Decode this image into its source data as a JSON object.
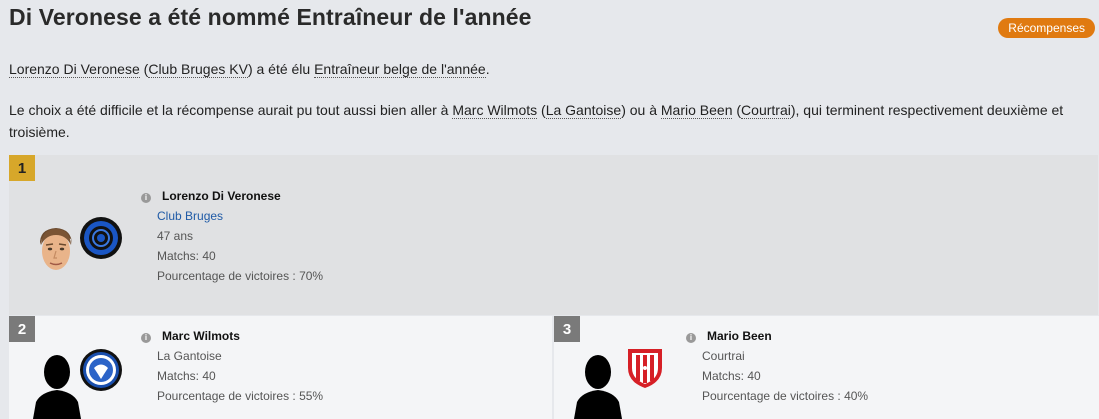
{
  "header": {
    "title": "Di Veronese a été nommé Entraîneur de l'année",
    "badge": "Récompenses"
  },
  "intro": {
    "coach": "Lorenzo Di Veronese",
    "club_open": " (",
    "club": "Club Bruges KV",
    "mid": ") a été élu ",
    "award": "Entraîneur belge de l'année",
    "end": "."
  },
  "detail": {
    "t1": "Le choix a été difficile et la récompense aurait pu tout aussi bien aller à ",
    "coach2": "Marc Wilmots",
    "p1": " (",
    "club2": "La Gantoise",
    "t2": ") ou à ",
    "coach3": "Mario Been",
    "p2": " (",
    "club3": "Courtrai",
    "t3": "), qui terminent respectivement deuxième et troisième."
  },
  "winners": [
    {
      "rank": "1",
      "name": "Lorenzo Di Veronese",
      "club": "Club Bruges",
      "age": "47 ans",
      "matches": "Matchs: 40",
      "win": "Pourcentage de victoires : 70%"
    },
    {
      "rank": "2",
      "name": "Marc Wilmots",
      "club": "La Gantoise",
      "matches": "Matchs: 40",
      "win": "Pourcentage de victoires : 55%"
    },
    {
      "rank": "3",
      "name": "Mario Been",
      "club": "Courtrai",
      "matches": "Matchs: 40",
      "win": "Pourcentage de victoires : 40%"
    }
  ],
  "colors": {
    "accent": "#e07a10",
    "gold": "#d7a72a",
    "link": "#1f5aa6"
  }
}
